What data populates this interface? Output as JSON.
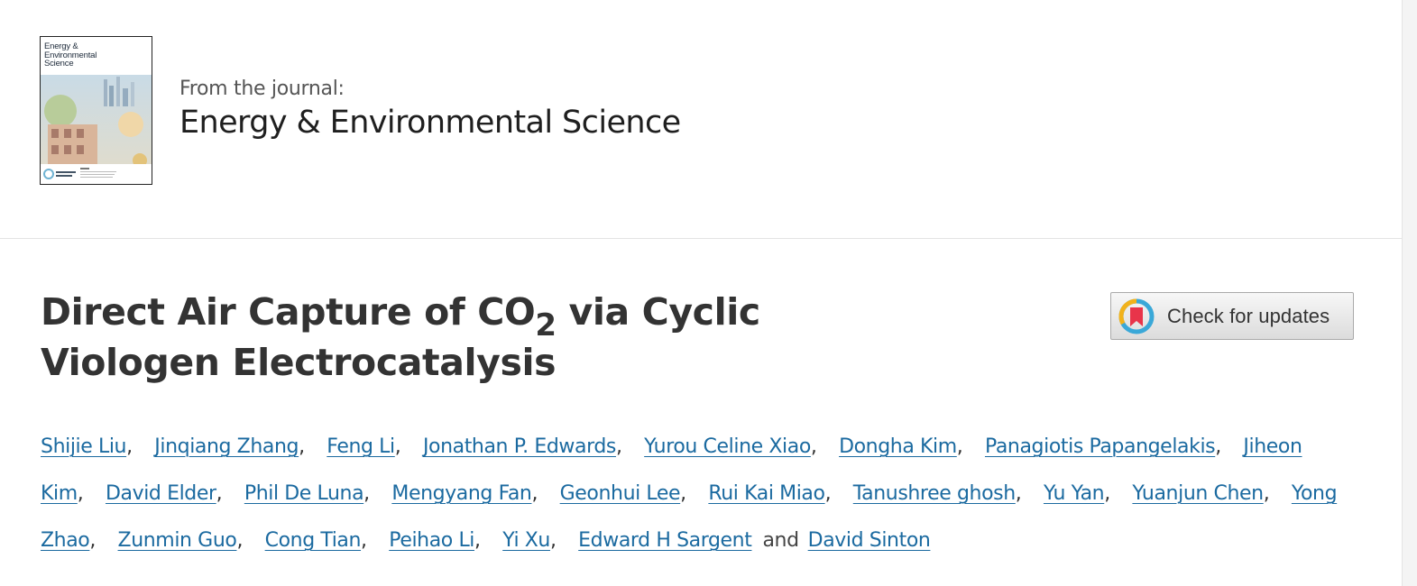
{
  "journal": {
    "from_label": "From the journal:",
    "name": "Energy & Environmental Science",
    "cover": {
      "title_lines": [
        "Energy &",
        "Environmental",
        "Science"
      ]
    }
  },
  "article": {
    "title_part1": "Direct Air Capture of CO",
    "title_sub": "2",
    "title_part2": " via Cyclic Viologen Electrocatalysis",
    "check_updates_label": "Check for updates"
  },
  "authors": [
    "Shijie Liu",
    "Jinqiang Zhang",
    "Feng Li",
    "Jonathan P. Edwards",
    "Yurou Celine Xiao",
    "Dongha Kim",
    "Panagiotis Papangelakis",
    "Jiheon Kim",
    "David Elder",
    "Phil De Luna",
    "Mengyang Fan",
    "Geonhui Lee",
    "Rui Kai Miao",
    "Tanushree ghosh",
    "Yu Yan",
    "Yuanjun Chen",
    "Yong Zhao",
    "Zunmin Guo",
    "Cong Tian",
    "Peihao Li",
    "Yi Xu",
    "Edward H Sargent",
    "David Sinton"
  ],
  "authors_separator": ",",
  "authors_conjunction": "and",
  "colors": {
    "link": "#1b6aa0",
    "text": "#333333",
    "badge_red": "#e8344a",
    "badge_yellow": "#f2b21b",
    "badge_blue": "#3aa8d8"
  }
}
